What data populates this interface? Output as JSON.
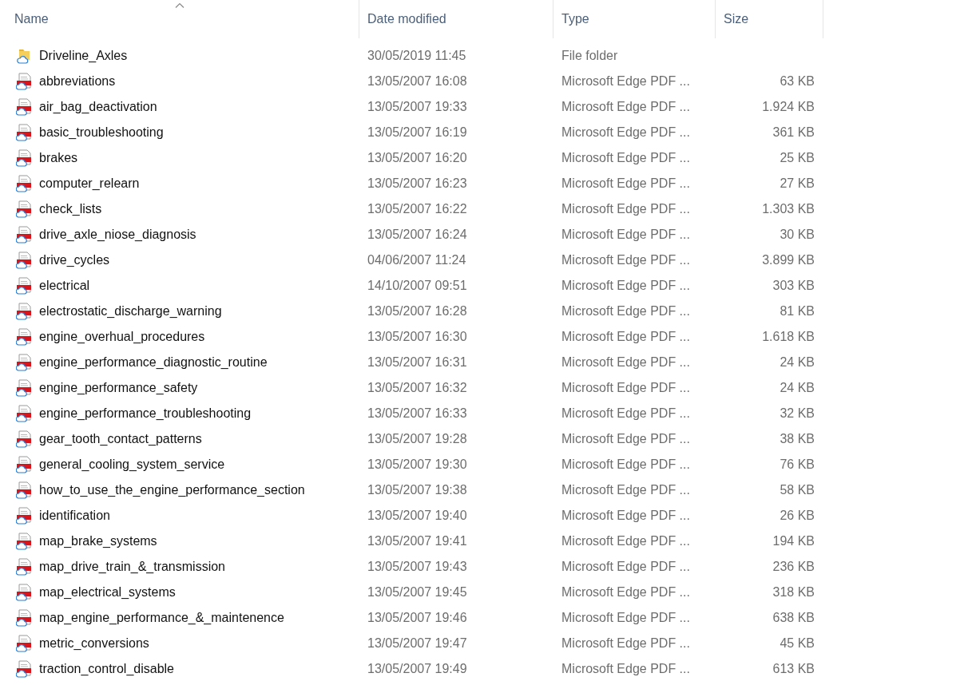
{
  "columns": [
    {
      "label": "Name",
      "sorted": true
    },
    {
      "label": "Date modified",
      "sorted": false
    },
    {
      "label": "Type",
      "sorted": false
    },
    {
      "label": "Size",
      "sorted": false
    }
  ],
  "rows": [
    {
      "kind": "folder",
      "name": "Driveline_Axles",
      "date": "30/05/2019 11:45",
      "type": "File folder"
    },
    {
      "kind": "pdf",
      "name": "abbreviations",
      "date": "13/05/2007 16:08",
      "type": "Microsoft Edge PDF ...",
      "size": "63 KB"
    },
    {
      "kind": "pdf",
      "name": "air_bag_deactivation",
      "date": "13/05/2007 19:33",
      "type": "Microsoft Edge PDF ...",
      "size": "1.924 KB"
    },
    {
      "kind": "pdf",
      "name": "basic_troubleshooting",
      "date": "13/05/2007 16:19",
      "type": "Microsoft Edge PDF ...",
      "size": "361 KB"
    },
    {
      "kind": "pdf",
      "name": "brakes",
      "date": "13/05/2007 16:20",
      "type": "Microsoft Edge PDF ...",
      "size": "25 KB"
    },
    {
      "kind": "pdf",
      "name": "computer_relearn",
      "date": "13/05/2007 16:23",
      "type": "Microsoft Edge PDF ...",
      "size": "27 KB"
    },
    {
      "kind": "pdf",
      "name": "check_lists",
      "date": "13/05/2007 16:22",
      "type": "Microsoft Edge PDF ...",
      "size": "1.303 KB"
    },
    {
      "kind": "pdf",
      "name": "drive_axle_niose_diagnosis",
      "date": "13/05/2007 16:24",
      "type": "Microsoft Edge PDF ...",
      "size": "30 KB"
    },
    {
      "kind": "pdf",
      "name": "drive_cycles",
      "date": "04/06/2007 11:24",
      "type": "Microsoft Edge PDF ...",
      "size": "3.899 KB"
    },
    {
      "kind": "pdf",
      "name": "electrical",
      "date": "14/10/2007 09:51",
      "type": "Microsoft Edge PDF ...",
      "size": "303 KB"
    },
    {
      "kind": "pdf",
      "name": "electrostatic_discharge_warning",
      "date": "13/05/2007 16:28",
      "type": "Microsoft Edge PDF ...",
      "size": "81 KB"
    },
    {
      "kind": "pdf",
      "name": "engine_overhual_procedures",
      "date": "13/05/2007 16:30",
      "type": "Microsoft Edge PDF ...",
      "size": "1.618 KB"
    },
    {
      "kind": "pdf",
      "name": "engine_performance_diagnostic_routine",
      "date": "13/05/2007 16:31",
      "type": "Microsoft Edge PDF ...",
      "size": "24 KB"
    },
    {
      "kind": "pdf",
      "name": "engine_performance_safety",
      "date": "13/05/2007 16:32",
      "type": "Microsoft Edge PDF ...",
      "size": "24 KB"
    },
    {
      "kind": "pdf",
      "name": "engine_performance_troubleshooting",
      "date": "13/05/2007 16:33",
      "type": "Microsoft Edge PDF ...",
      "size": "32 KB"
    },
    {
      "kind": "pdf",
      "name": "gear_tooth_contact_patterns",
      "date": "13/05/2007 19:28",
      "type": "Microsoft Edge PDF ...",
      "size": "38 KB"
    },
    {
      "kind": "pdf",
      "name": "general_cooling_system_service",
      "date": "13/05/2007 19:30",
      "type": "Microsoft Edge PDF ...",
      "size": "76 KB"
    },
    {
      "kind": "pdf",
      "name": "how_to_use_the_engine_performance_section",
      "date": "13/05/2007 19:38",
      "type": "Microsoft Edge PDF ...",
      "size": "58 KB"
    },
    {
      "kind": "pdf",
      "name": "identification",
      "date": "13/05/2007 19:40",
      "type": "Microsoft Edge PDF ...",
      "size": "26 KB"
    },
    {
      "kind": "pdf",
      "name": "map_brake_systems",
      "date": "13/05/2007 19:41",
      "type": "Microsoft Edge PDF ...",
      "size": "194 KB"
    },
    {
      "kind": "pdf",
      "name": "map_drive_train_&_transmission",
      "date": "13/05/2007 19:43",
      "type": "Microsoft Edge PDF ...",
      "size": "236 KB"
    },
    {
      "kind": "pdf",
      "name": "map_electrical_systems",
      "date": "13/05/2007 19:45",
      "type": "Microsoft Edge PDF ...",
      "size": "318 KB"
    },
    {
      "kind": "pdf",
      "name": "map_engine_performance_&_maintenence",
      "date": "13/05/2007 19:46",
      "type": "Microsoft Edge PDF ...",
      "size": "638 KB"
    },
    {
      "kind": "pdf",
      "name": "metric_conversions",
      "date": "13/05/2007 19:47",
      "type": "Microsoft Edge PDF ...",
      "size": "45 KB"
    },
    {
      "kind": "pdf",
      "name": "traction_control_disable",
      "date": "13/05/2007 19:49",
      "type": "Microsoft Edge PDF ...",
      "size": "613 KB"
    }
  ]
}
